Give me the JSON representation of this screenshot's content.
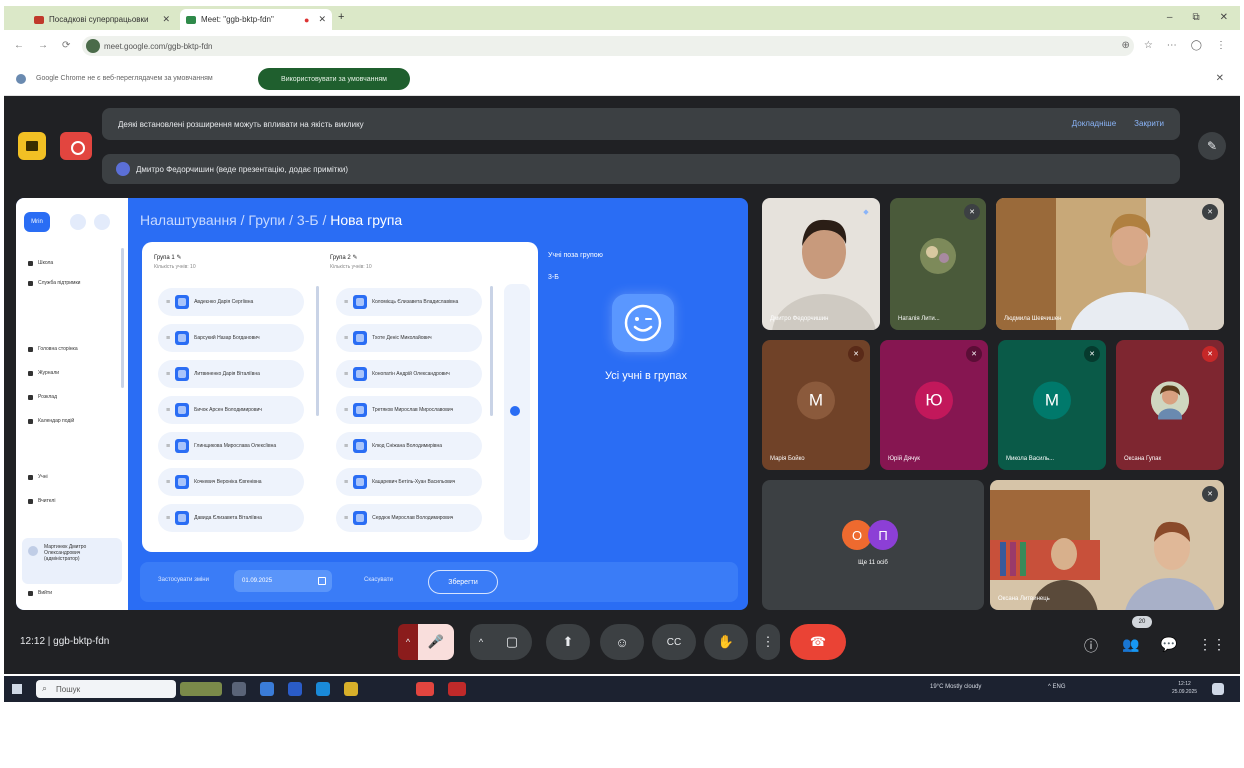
{
  "browser": {
    "tabs": [
      {
        "title": "Посадкові суперпрацьовки",
        "active": false
      },
      {
        "title": "Meet: \"ggb-bktp-fdn\"",
        "active": true
      }
    ],
    "new_tab": "+",
    "window_controls": [
      "–",
      "⧉",
      "✕"
    ],
    "nav_buttons": [
      "←",
      "→",
      "⟳"
    ],
    "url": "meet.google.com/ggb-bktp-fdn",
    "omnibox_icons": [
      "⊕",
      "☆",
      "⋯",
      "◯",
      "⋮"
    ],
    "infobar": {
      "message": "Google Chrome не є веб-переглядачем за умовчанням",
      "button": "Використовувати за умовчанням",
      "close": "✕"
    }
  },
  "meet": {
    "banner_warning": "Деякі встановлені розширення можуть впливати на якість виклику",
    "banner_actions": [
      "Докладніше",
      "Закрити"
    ],
    "presenter_banner": "Дмитро Федорчишин (веде презентацію, додає примітки)",
    "presentation": {
      "breadcrumb": {
        "prefix": "Налаштування / Групи / 3-Б / ",
        "current": "Нова група"
      },
      "logo_text": "Mrin",
      "sidebar_items": [
        "Школа",
        "Служба підтримки",
        "Головна сторінка",
        "Журнали",
        "Розклад",
        "Календар подій",
        "Учні",
        "Вчителі",
        "Мартинюк Дмитро Олександрович (адміністратор)",
        "Вийти"
      ],
      "group1": {
        "title": "Група 1 ✎",
        "subtitle": "Кількість учнів: 10",
        "students": [
          "Авдеєнко Дарія Сергіївна",
          "Барсукий Назар Богданович",
          "Литвиненко Дарія Віталіївна",
          "Бичок Арсен Володимирович",
          "Глинщикова Мирослава Олексіївна",
          "Кочкевич Вероніка Євгенівна",
          "Давида Єлизавета Віталіївна"
        ]
      },
      "group2": {
        "title": "Група 2 ✎",
        "subtitle": "Кількість учнів: 10",
        "students": [
          "Коломієць Єлизавета Владиславівна",
          "Тхоте Деніс Миколайович",
          "Конопатін Андрій Олександрович",
          "Третяков Мирослав Мирославович",
          "Клюд Сніжана Володимирівна",
          "Кацаревич Бетіль-Хуан Васильович",
          "Сердюк Мирослав Володимирович"
        ]
      },
      "no_group_title": "Учні поза групою",
      "no_group_class": "3-Б",
      "all_in_groups": "Усі учні в групах",
      "footer": {
        "label_date": "Застосувати зміни",
        "date": "01.09.2025",
        "cancel": "Скасувати",
        "save": "Зберегти"
      }
    },
    "participants": [
      {
        "name": "Дмитро Федорчишин",
        "avatar": "",
        "color": "#6b5a4a"
      },
      {
        "name": "Наталія Лити...",
        "avatar": "",
        "color": "#4a5a3a"
      },
      {
        "name": "Людмила Шевчишен",
        "avatar": "",
        "color": "#9a7c55"
      },
      {
        "name": "Марія Бойко",
        "avatar": "М",
        "color": "#704228"
      },
      {
        "name": "Юрій Дячук",
        "avatar": "Ю",
        "color": "#861651"
      },
      {
        "name": "Микола Василь...",
        "avatar": "М",
        "color": "#0a5a48"
      },
      {
        "name": "Оксана Гупак",
        "avatar": "",
        "color": "#7e2630"
      },
      {
        "name": "Оксана Литвинець",
        "avatar": "",
        "color": "#8a6a45"
      }
    ],
    "others": {
      "avatars": [
        "О",
        "П"
      ],
      "label": "Ще 11 осіб"
    },
    "meeting_code": "12:12  |  ggb-bktp-fdn",
    "people_count": "20",
    "controls": {
      "arrow": "^",
      "mic_off": "🎤",
      "cam": "▢",
      "present": "⬆",
      "emoji": "☺",
      "captions": "CC",
      "hand": "✋",
      "more": "⋮",
      "hangup": "☎"
    },
    "right_tools": [
      "ⓘ",
      "👥",
      "💬",
      "⋮⋮"
    ]
  },
  "taskbar": {
    "search": "Пошук",
    "weather": "19°C  Mostly cloudy",
    "tray": "^  ENG",
    "time": "12:12",
    "date": "25.09.2025"
  }
}
